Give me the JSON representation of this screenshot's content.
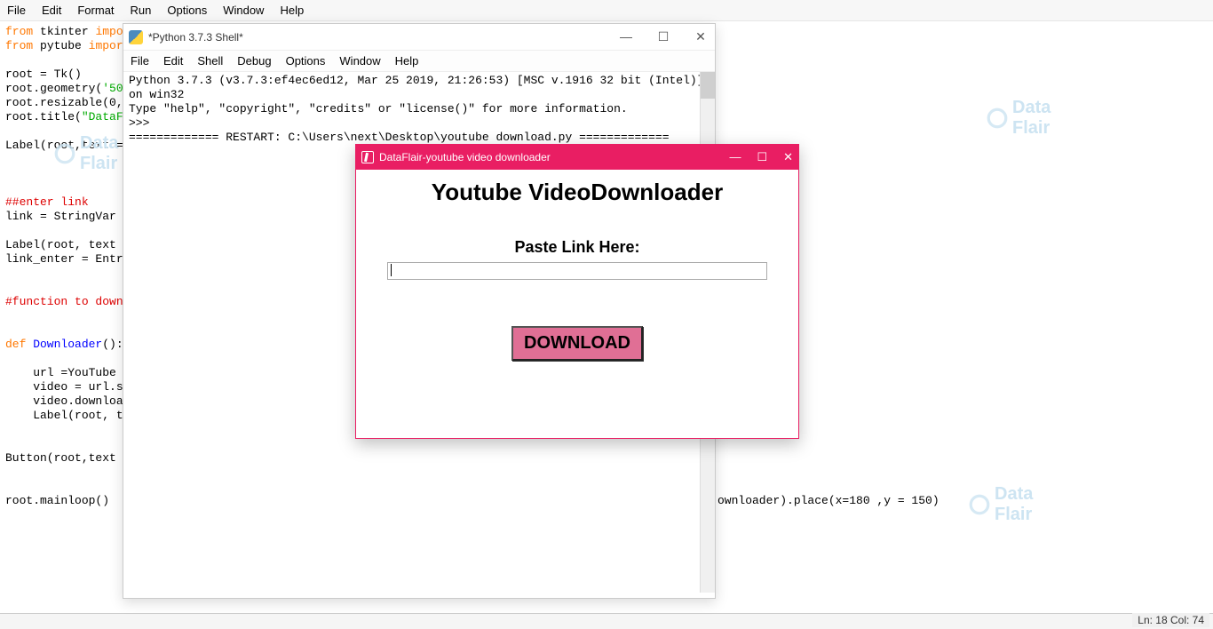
{
  "editor": {
    "menu": [
      "File",
      "Edit",
      "Format",
      "Run",
      "Options",
      "Window",
      "Help"
    ],
    "code": {
      "l1a": "from",
      "l1b": " tkinter ",
      "l1c": "impo",
      "l2a": "from",
      "l2b": " pytube ",
      "l2c": "impor",
      "l4": "root = Tk()",
      "l5a": "root.geometry(",
      "l5b": "'50",
      "l6": "root.resizable(0,",
      "l7a": "root.title(",
      "l7b": "\"DataF",
      "l9": "Label(root,text =",
      "l12": "##enter link",
      "l13": "link = StringVar",
      "l15": "Label(root, text",
      "l16": "link_enter = Entr",
      "l19": "#function to down",
      "l21a": "def",
      "l21b": " Downloader",
      "l21c": "():",
      "l23": "    url =YouTube",
      "l24": "    video = url.s",
      "l25": "    video.downloa",
      "l26": "    Label(root, t",
      "l28a": "Button(root,text",
      "l28b": "ownloader).place(x=180 ,y = 150)",
      "l31": "root.mainloop()"
    },
    "status": "Ln: 18  Col: 74"
  },
  "shell": {
    "title": "*Python 3.7.3 Shell*",
    "menu": [
      "File",
      "Edit",
      "Shell",
      "Debug",
      "Options",
      "Window",
      "Help"
    ],
    "line1": "Python 3.7.3 (v3.7.3:ef4ec6ed12, Mar 25 2019, 21:26:53) [MSC v.1916 32 bit (Intel)] on win32",
    "line2": "Type \"help\", \"copyright\", \"credits\" or \"license()\" for more information.",
    "prompt": ">>>",
    "restart": "============= RESTART: C:\\Users\\next\\Desktop\\youtube download.py ============="
  },
  "app": {
    "title": "DataFlair-youtube video downloader",
    "heading": "Youtube VideoDownloader",
    "label": "Paste Link Here:",
    "entry_value": "",
    "button": "DOWNLOAD"
  },
  "watermark_text_top": "Data",
  "watermark_text_bot": "Flair",
  "win_ctrl": {
    "min": "—",
    "max": "☐",
    "close": "✕"
  }
}
